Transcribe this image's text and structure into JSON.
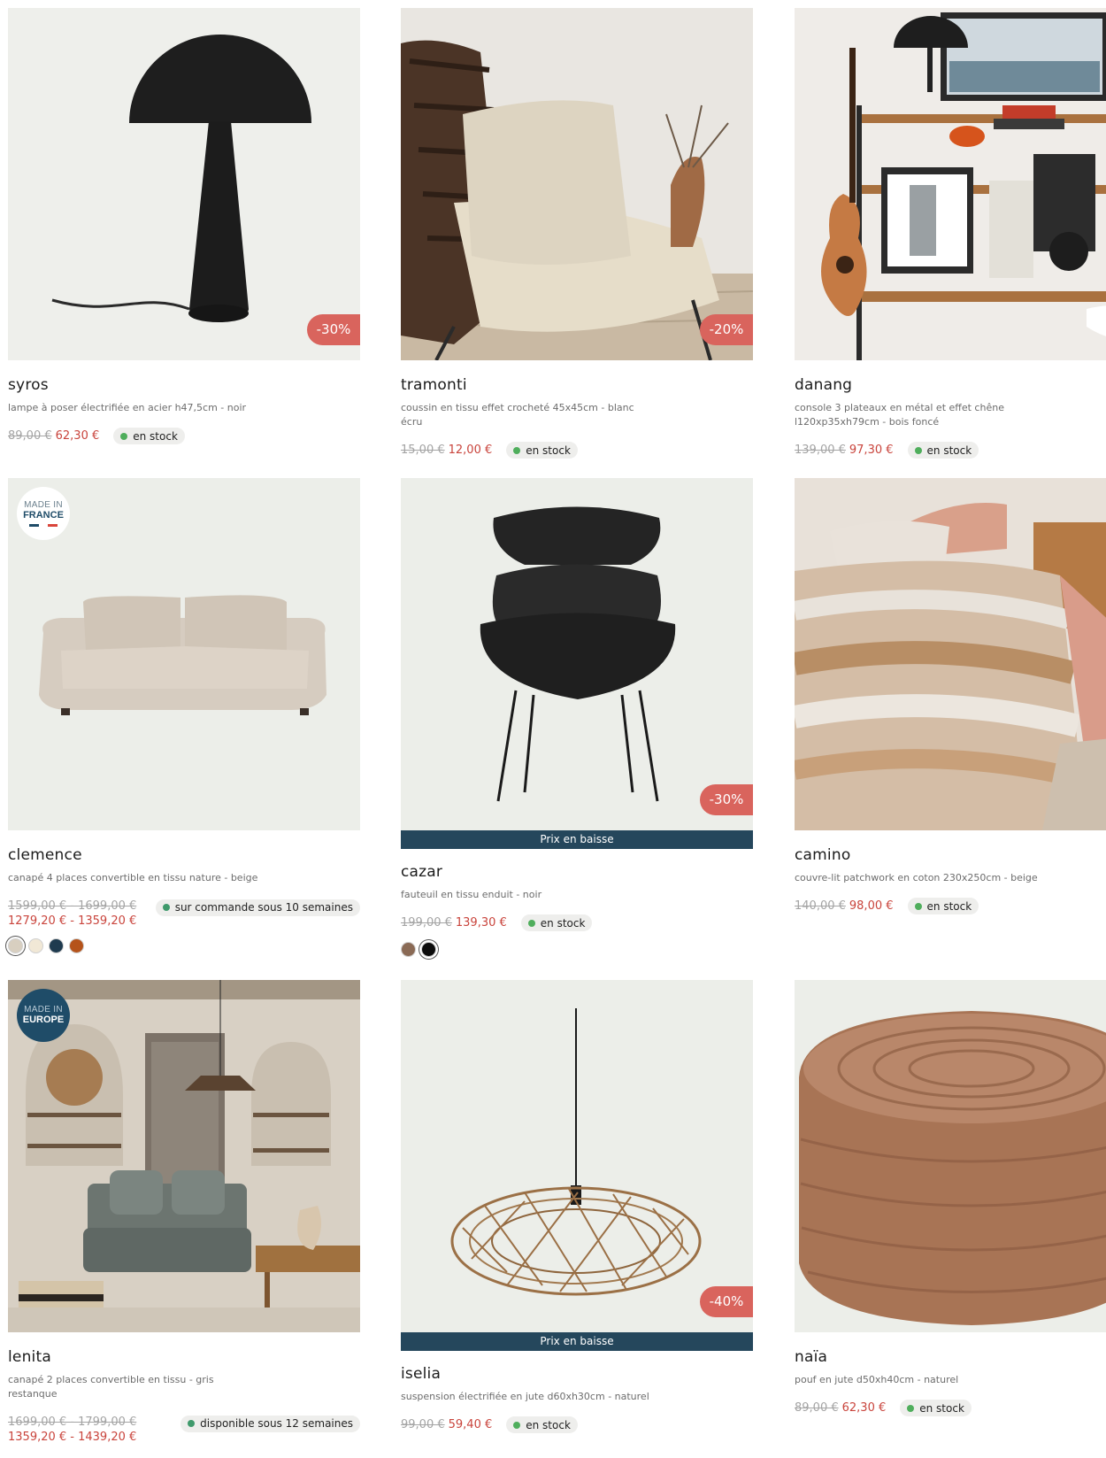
{
  "products": [
    {
      "name": "syros",
      "description": "lampe à poser électrifiée en acier h47,5cm - noir",
      "old_price": "89,00 €",
      "new_price": "62,30 €",
      "stock": "en stock",
      "discount": "-30%"
    },
    {
      "name": "tramonti",
      "description": "coussin en tissu effet crocheté 45x45cm - blanc écru",
      "old_price": "15,00 €",
      "new_price": "12,00 €",
      "stock": "en stock",
      "discount": "-20%"
    },
    {
      "name": "danang",
      "description": "console 3 plateaux en métal et effet chêne l120xp35xh79cm - bois foncé",
      "old_price": "139,00 €",
      "new_price": "97,30 €",
      "stock": "en stock"
    },
    {
      "name": "clemence",
      "description": "canapé 4 places convertible en tissu nature - beige",
      "old_price": "1599,00 € - 1699,00 €",
      "new_price": "1279,20 € - 1359,20 €",
      "stock": "sur commande sous 10 semaines",
      "badge": {
        "line1": "MADE IN",
        "line2": "FRANCE"
      },
      "swatches": [
        "#d8cfc0",
        "#f1e8d6",
        "#1f3b4f",
        "#b5531b"
      ]
    },
    {
      "name": "cazar",
      "description": "fauteuil en tissu enduit - noir",
      "old_price": "199,00 €",
      "new_price": "139,30 €",
      "stock": "en stock",
      "discount": "-30%",
      "band": "Prix en baisse",
      "swatches": [
        "#8a6a55",
        "#0b0b0b"
      ]
    },
    {
      "name": "camino",
      "description": "couvre-lit patchwork en coton 230x250cm - beige",
      "old_price": "140,00 €",
      "new_price": "98,00 €",
      "stock": "en stock"
    },
    {
      "name": "lenita",
      "description": "canapé 2 places convertible en tissu - gris restanque",
      "old_price": "1699,00 € - 1799,00 €",
      "new_price": "1359,20 € - 1439,20 €",
      "stock": "disponible sous 12 semaines",
      "badge": {
        "line1": "MADE IN",
        "line2": "EUROPE"
      }
    },
    {
      "name": "iselia",
      "description": "suspension électrifiée en jute d60xh30cm - naturel",
      "old_price": "99,00 €",
      "new_price": "59,40 €",
      "stock": "en stock",
      "discount": "-40%",
      "band": "Prix en baisse"
    },
    {
      "name": "naïa",
      "description": "pouf en jute d50xh40cm - naturel",
      "old_price": "89,00 €",
      "new_price": "62,30 €",
      "stock": "en stock"
    }
  ],
  "colors": {
    "price_accent": "#c9443c",
    "discount_badge": "#d9645d",
    "price_band": "#25475c",
    "stock_dot": "#4fae5c",
    "image_background": "#edefea"
  }
}
